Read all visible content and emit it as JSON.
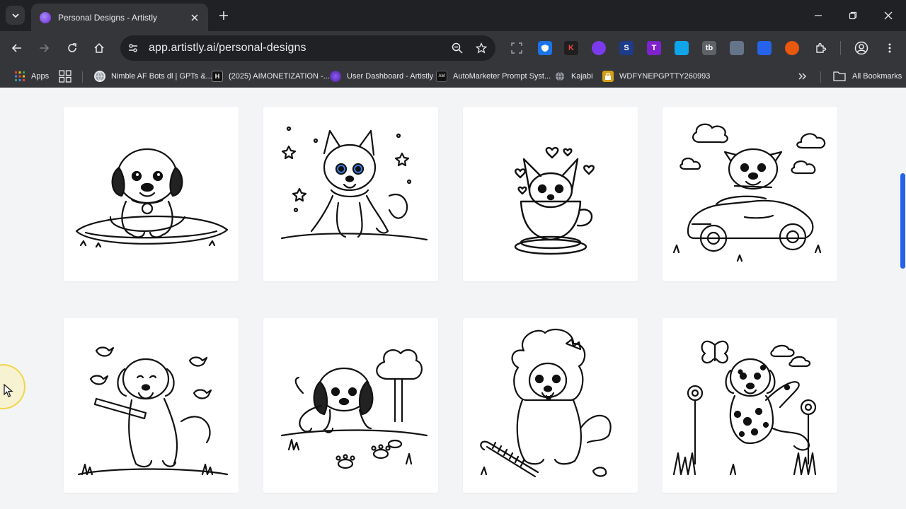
{
  "browser": {
    "tab": {
      "title": "Personal Designs - Artistly"
    },
    "url": "app.artistly.ai/personal-designs",
    "bookmarks": [
      {
        "label": "Apps",
        "icon": "apps-grid-icon"
      },
      {
        "label": "Nimble AF Bots dl | GPTs &...",
        "icon": "globe-icon"
      },
      {
        "label": "(2025) AIMONETIZATION -...",
        "icon": "h-logo-icon"
      },
      {
        "label": "User Dashboard - Artistly",
        "icon": "artistly-icon"
      },
      {
        "label": "AutoMarketer Prompt Syst...",
        "icon": "automarketer-icon"
      },
      {
        "label": "Kajabi",
        "icon": "globe-icon"
      },
      {
        "label": "WDFYNEPGPTTY260993",
        "icon": "lock-folder-icon"
      }
    ],
    "all_bookmarks": "All Bookmarks",
    "extensions": [
      {
        "name": "k-extension-icon",
        "letter": "K",
        "color": "#1f1f1f",
        "fg": "#ef4444"
      },
      {
        "name": "eye-extension-icon",
        "letter": "",
        "color": "#7c3aed"
      },
      {
        "name": "s-extension-icon",
        "letter": "S",
        "color": "#1e3a8a"
      },
      {
        "name": "t-extension-icon",
        "letter": "T",
        "color": "#7e22ce"
      },
      {
        "name": "image-extension-icon",
        "letter": "",
        "color": "#0ea5e9"
      },
      {
        "name": "tb-extension-icon",
        "letter": "tb",
        "color": "#5f6368"
      },
      {
        "name": "photo-extension-icon",
        "letter": "",
        "color": "#64748b"
      },
      {
        "name": "cube-extension-icon",
        "letter": "",
        "color": "#2563eb"
      },
      {
        "name": "chat-extension-icon",
        "letter": "",
        "color": "#ea580c"
      }
    ]
  },
  "gallery": {
    "designs": [
      {
        "name": "puppy-on-blanket-design",
        "subject": "puppy sitting on blanket"
      },
      {
        "name": "husky-puppy-stars-design",
        "subject": "husky puppy with stars"
      },
      {
        "name": "chihuahua-teacup-design",
        "subject": "chihuahua in teacup"
      },
      {
        "name": "pug-in-car-design",
        "subject": "pug driving car"
      },
      {
        "name": "puppy-with-stick-design",
        "subject": "puppy with stick and birds"
      },
      {
        "name": "puppy-pawprints-design",
        "subject": "puppy sniffing paw prints"
      },
      {
        "name": "poodle-with-brush-design",
        "subject": "poodle with brush"
      },
      {
        "name": "dalmatian-butterfly-design",
        "subject": "dalmatian with butterfly"
      }
    ]
  },
  "colors": {
    "accent": "#2563eb",
    "page_bg": "#f3f4f6",
    "chrome_bg": "#35363a"
  }
}
